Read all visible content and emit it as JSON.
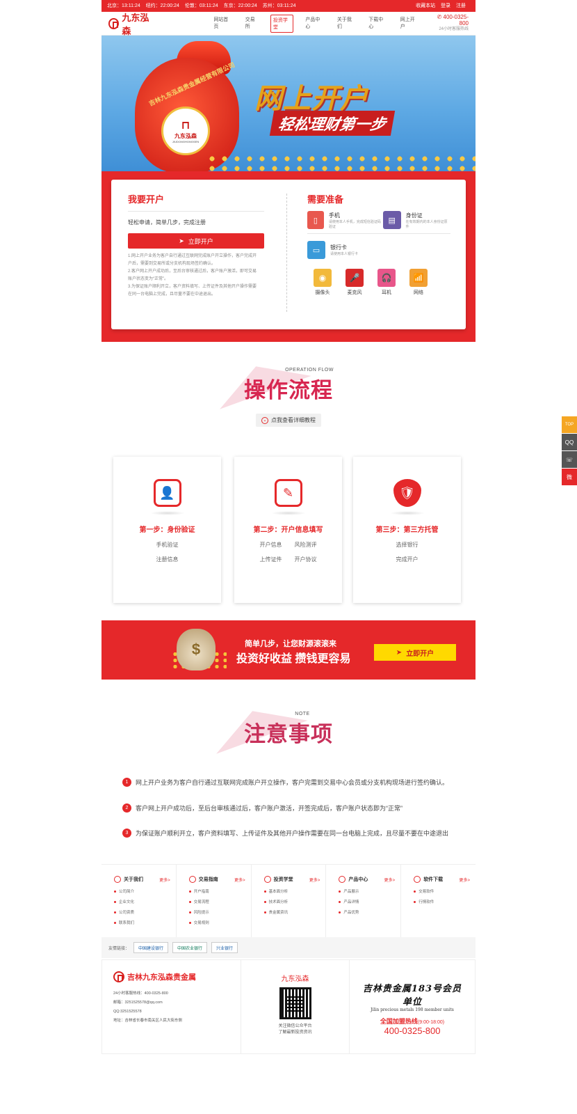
{
  "topbar": {
    "times": [
      "北京：13:11:24",
      "纽约：22:00:24",
      "伦敦：03:11:24",
      "东京：22:00:24",
      "苏州：03:11:24"
    ],
    "links": [
      "收藏本站",
      "登录",
      "注册"
    ]
  },
  "nav": {
    "logo": "九东泓森",
    "menu": [
      "网站首页",
      "交易所",
      "投资学堂",
      "产品中心",
      "关于我们",
      "下载中心",
      "网上开户"
    ],
    "active_index": 2,
    "phone": "400-0325-800",
    "phone_note": "24小时客服热线"
  },
  "hero": {
    "title": "网上开户",
    "subtitle": "轻松理财第一步",
    "bag_logo": "九东泓森",
    "bag_logo_en": "JIUDONGHONGSEN",
    "bag_text": "吉林九东泓森贵金属经营有限公司"
  },
  "open": {
    "title": "我要开户",
    "subtitle": "轻松申请，简单几步，完成注册",
    "button": "立即开户",
    "notes": [
      "1.网上开户业务为客户自行通过互联网完成账户开立操作，客户完成开",
      "户后，需要到交易所或分支机构现场签约确认。",
      "2.客户网上开户成功后，至后台审核通过后，客户账户激活，即可交易",
      "账户状态变为“正常”。",
      "3.为保证账户顺利开立，客户资料填写、上传证件及其他开户操作需要",
      "在同一台电脑上完成，且尽量不要在中途退出。"
    ]
  },
  "prepare": {
    "title": "需要准备",
    "items": [
      {
        "name": "手机",
        "desc": "请使用本人手机，完成短信验证码验证",
        "color": "#e8584e",
        "icon": "phone-icon"
      },
      {
        "name": "身份证",
        "desc": "在有效期内的本人身份证原件",
        "color": "#6b5ba8",
        "icon": "id-card-icon"
      },
      {
        "name": "银行卡",
        "desc": "请使用本人银行卡",
        "color": "#3a9ad9",
        "icon": "bank-card-icon"
      }
    ],
    "devices": [
      {
        "name": "摄像头",
        "color": "#f2b93b",
        "glyph": "◉"
      },
      {
        "name": "麦克风",
        "color": "#d72a2a",
        "glyph": "🎤"
      },
      {
        "name": "耳机",
        "color": "#e8568a",
        "glyph": "🎧"
      },
      {
        "name": "网络",
        "color": "#f1a033",
        "glyph": "📶"
      }
    ]
  },
  "flow": {
    "en": "OPERATION FLOW",
    "title": "操作流程",
    "link": "点我查看详细教程",
    "steps": [
      {
        "title": "第一步：身份验证",
        "items": [
          "手机验证",
          "注册信息"
        ],
        "glyph": "👤"
      },
      {
        "title": "第二步：开户信息填写",
        "items": [
          "开户信息",
          "风险测评",
          "上传证件",
          "开户协议"
        ],
        "glyph": "✎"
      },
      {
        "title": "第三步：第三方托管",
        "items": [
          "选择银行",
          "完成开户"
        ],
        "glyph": "🛡"
      }
    ]
  },
  "banner2": {
    "line1": "简单几步，让您财源滚滚来",
    "line2": "投资好收益 攒钱更容易",
    "button": "立即开户",
    "bag_glyph": "$"
  },
  "note": {
    "en": "NOTE",
    "title": "注意事项",
    "items": [
      "网上开户业务为客户自行通过互联网完成账户开立操作，客户完需到交易中心会员或分支机构现场进行签约确认。",
      "客户网上开户成功后，至后台审核通过后，客户账户激活，开签完成后，客户账户状态即为“正常”",
      "为保证账户顺利开立，客户资料填写、上传证件及其他开户操作需要在同一台电脑上完成，且尽量不要在中途退出"
    ]
  },
  "footer": {
    "cols": [
      {
        "title": "关于我们",
        "more": "更多>",
        "items": [
          "公司简介",
          "企业文化",
          "公司资质",
          "联系我们"
        ]
      },
      {
        "title": "交易指南",
        "more": "更多>",
        "items": [
          "开户指南",
          "交易流程",
          "风险提示",
          "交易规则"
        ]
      },
      {
        "title": "投资学堂",
        "more": "更多>",
        "items": [
          "基本面分析",
          "技术面分析",
          "贵金属资讯"
        ]
      },
      {
        "title": "产品中心",
        "more": "更多>",
        "items": [
          "产品展示",
          "产品详情",
          "产品优势"
        ]
      },
      {
        "title": "软件下载",
        "more": "更多>",
        "items": [
          "交易软件",
          "行情软件"
        ]
      }
    ],
    "friends_label": "友情链接：",
    "friends": [
      "中国建设银行",
      "中国农业银行",
      "兴业银行"
    ],
    "company": "吉林九东泓森贵金属",
    "info": [
      "24小时客服热线：400-0325-800",
      "邮箱：3251525578@qq.com",
      "QQ:3251525578",
      "地址：吉林省长春市南关区人民大街东侧"
    ],
    "qr_title": "九东泓森",
    "qr_caption": [
      "关注微信公众平台",
      "了解最新投资资讯"
    ],
    "seal": "吉林贵金属183号会员单位",
    "seal_en": "Jilin precious metals 198 member units",
    "hotline_label": "全国加盟热线",
    "hotline_hours": "(9:00-18:00)",
    "hotline": "400-0325-800"
  },
  "side": [
    "TOP",
    "QQ",
    "☏",
    "微"
  ]
}
